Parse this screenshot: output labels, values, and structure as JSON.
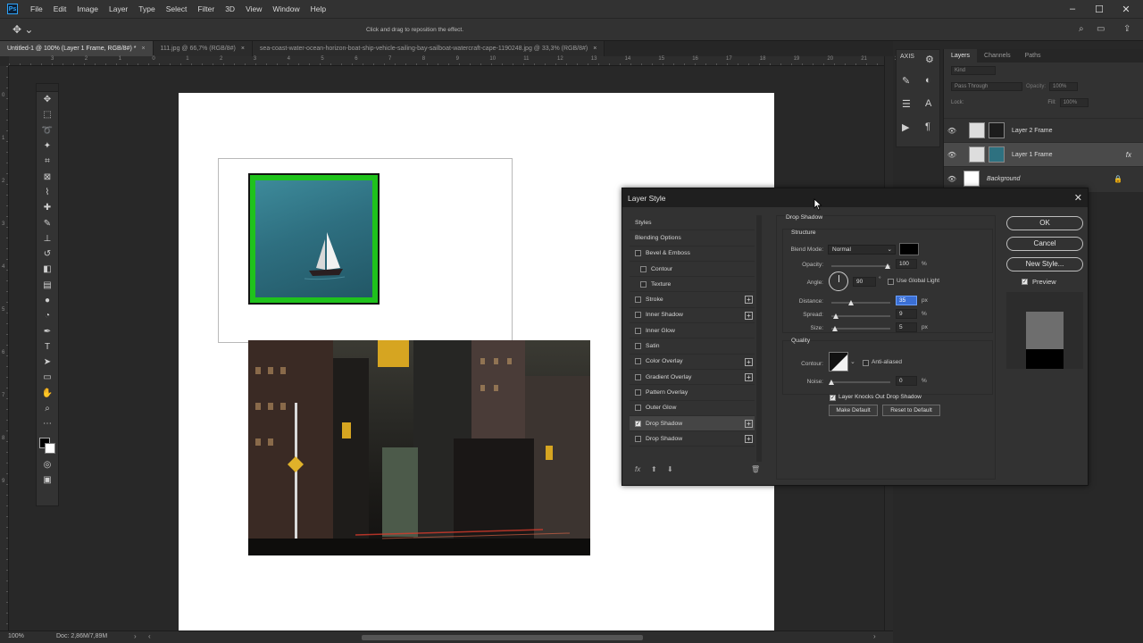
{
  "app": {
    "logo_text": "Ps",
    "menu": [
      "File",
      "Edit",
      "Image",
      "Layer",
      "Type",
      "Select",
      "Filter",
      "3D",
      "View",
      "Window",
      "Help"
    ]
  },
  "options_bar": {
    "hint": "Click and drag to reposition the effect."
  },
  "tabs": [
    {
      "label": "Untitled-1 @ 100% (Layer 1 Frame, RGB/8#) *",
      "active": true
    },
    {
      "label": "111.jpg @ 66,7% (RGB/8#)",
      "active": false
    },
    {
      "label": "sea-coast-water-ocean-horizon-boat-ship-vehicle-sailing-bay-sailboat-watercraft-cape-1190248.jpg @ 33,3% (RGB/8#)",
      "active": false
    }
  ],
  "ruler_h_labels": [
    "3",
    "2",
    "1",
    "0",
    "1",
    "2",
    "3",
    "4",
    "5",
    "6",
    "7",
    "8",
    "9",
    "10",
    "11",
    "12",
    "13",
    "14",
    "15",
    "16",
    "17",
    "18",
    "19",
    "20",
    "21",
    "22"
  ],
  "ruler_v_labels": [
    "0",
    "1",
    "2",
    "3",
    "4",
    "5",
    "6",
    "7",
    "8",
    "9"
  ],
  "status": {
    "zoom": "100%",
    "doc": "Doc: 2,86M/7,89M"
  },
  "layers_panel": {
    "tabs": [
      "Layers",
      "Channels",
      "Paths"
    ],
    "filter_placeholder": "Kind",
    "blend_mode": "Pass Through",
    "opacity_label": "Opacity:",
    "opacity_value": "100%",
    "lock_label": "Lock:",
    "fill_label": "Fill:",
    "fill_value": "100%",
    "layers": [
      {
        "name": "Layer 2 Frame",
        "selected": false
      },
      {
        "name": "Layer 1 Frame",
        "selected": true,
        "fx": "fx"
      },
      {
        "name": "Background",
        "selected": false
      }
    ]
  },
  "dialog": {
    "title": "Layer Style",
    "styles_list": [
      {
        "label": "Styles",
        "checkbox": false,
        "plus": false,
        "indent": 0
      },
      {
        "label": "Blending Options",
        "checkbox": false,
        "plus": false,
        "indent": 0
      },
      {
        "label": "Bevel & Emboss",
        "checkbox": true,
        "checked": false,
        "plus": false,
        "indent": 0
      },
      {
        "label": "Contour",
        "checkbox": true,
        "checked": false,
        "plus": false,
        "indent": 1
      },
      {
        "label": "Texture",
        "checkbox": true,
        "checked": false,
        "plus": false,
        "indent": 1
      },
      {
        "label": "Stroke",
        "checkbox": true,
        "checked": false,
        "plus": true,
        "indent": 0
      },
      {
        "label": "Inner Shadow",
        "checkbox": true,
        "checked": false,
        "plus": true,
        "indent": 0
      },
      {
        "label": "Inner Glow",
        "checkbox": true,
        "checked": false,
        "plus": false,
        "indent": 0
      },
      {
        "label": "Satin",
        "checkbox": true,
        "checked": false,
        "plus": false,
        "indent": 0
      },
      {
        "label": "Color Overlay",
        "checkbox": true,
        "checked": false,
        "plus": true,
        "indent": 0
      },
      {
        "label": "Gradient Overlay",
        "checkbox": true,
        "checked": false,
        "plus": true,
        "indent": 0
      },
      {
        "label": "Pattern Overlay",
        "checkbox": true,
        "checked": false,
        "plus": false,
        "indent": 0
      },
      {
        "label": "Outer Glow",
        "checkbox": true,
        "checked": false,
        "plus": false,
        "indent": 0
      },
      {
        "label": "Drop Shadow",
        "checkbox": true,
        "checked": true,
        "plus": true,
        "indent": 0,
        "selected": true
      },
      {
        "label": "Drop Shadow",
        "checkbox": true,
        "checked": false,
        "plus": true,
        "indent": 0
      }
    ],
    "section_title": "Drop Shadow",
    "structure": {
      "title": "Structure",
      "blend_mode_label": "Blend Mode:",
      "blend_mode_value": "Normal",
      "shadow_color": "#000000",
      "opacity_label": "Opacity:",
      "opacity_value": "100",
      "opacity_unit": "%",
      "angle_label": "Angle:",
      "angle_value": "90",
      "angle_unit": "°",
      "global_light_label": "Use Global Light",
      "distance_label": "Distance:",
      "distance_value": "35",
      "distance_unit": "px",
      "spread_label": "Spread:",
      "spread_value": "9",
      "spread_unit": "%",
      "size_label": "Size:",
      "size_value": "5",
      "size_unit": "px"
    },
    "quality": {
      "title": "Quality",
      "contour_label": "Contour:",
      "anti_aliased_label": "Anti-aliased",
      "noise_label": "Noise:",
      "noise_value": "0",
      "noise_unit": "%"
    },
    "knockout_label": "Layer Knocks Out Drop Shadow",
    "make_default": "Make Default",
    "reset_default": "Reset to Default",
    "ok": "OK",
    "cancel": "Cancel",
    "new_style": "New Style...",
    "preview_label": "Preview",
    "fx_label": "fx"
  },
  "colors": {
    "frame_green": "#1fc21c",
    "selection_blue": "#3b6fd4"
  }
}
